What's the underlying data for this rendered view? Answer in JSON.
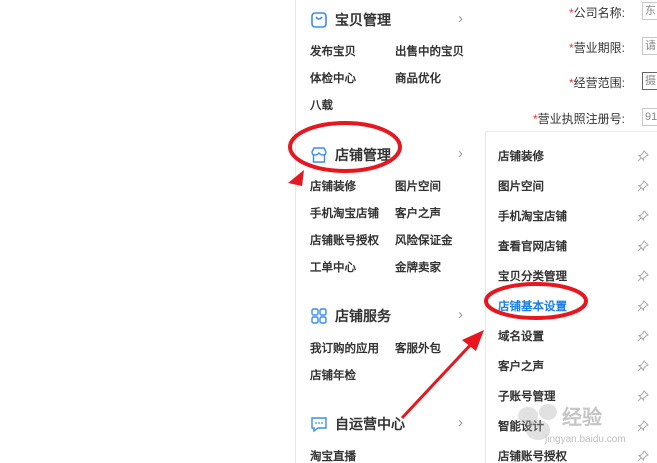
{
  "sidebar": {
    "sections": [
      {
        "title": "宝贝管理",
        "icon": "bag-icon",
        "items": [
          "发布宝贝",
          "出售中的宝贝",
          "体检中心",
          "商品优化",
          "八载"
        ]
      },
      {
        "title": "店铺管理",
        "icon": "shop-icon",
        "items": [
          "店铺装修",
          "图片空间",
          "手机淘宝店铺",
          "客户之声",
          "店铺账号授权",
          "风险保证金",
          "工单中心",
          "金牌卖家"
        ]
      },
      {
        "title": "店铺服务",
        "icon": "grid-icon",
        "items": [
          "我订购的应用",
          "客服外包",
          "店铺年检"
        ]
      },
      {
        "title": "自运营中心",
        "icon": "chat-icon",
        "items": [
          "淘宝直播"
        ]
      }
    ]
  },
  "flyout": {
    "items": [
      "店铺装修",
      "图片空间",
      "手机淘宝店铺",
      "查看官网店铺",
      "宝贝分类管理",
      "店铺基本设置",
      "域名设置",
      "客户之声",
      "子账号管理",
      "智能设计",
      "店铺账号授权"
    ],
    "active_index": 5
  },
  "form": {
    "fields": [
      {
        "required": "*",
        "label": "公司名称:",
        "value": "东"
      },
      {
        "required": "*",
        "label": "营业期限:",
        "value": "请"
      },
      {
        "required": "*",
        "label": "经营范围:",
        "value": "摄"
      },
      {
        "required": "*",
        "label": "营业执照注册号:",
        "value": "91"
      }
    ]
  },
  "watermark": {
    "text": "经验",
    "sub": "jingyan.baidu.com"
  },
  "colors": {
    "accent": "#1a7fe8",
    "annotation": "#e8161e",
    "required": "#e4393c"
  }
}
